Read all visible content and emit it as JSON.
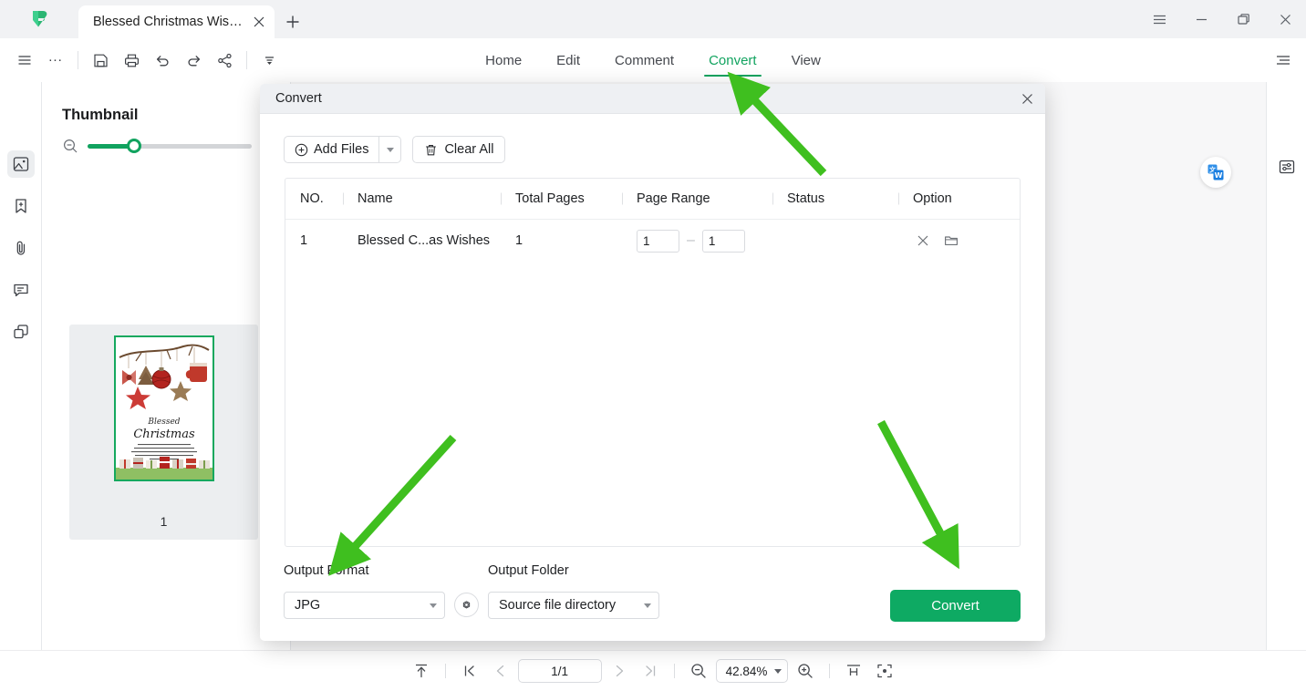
{
  "window": {
    "tab_title": "Blessed Christmas Wishe...",
    "tab_close_icon": "close-icon",
    "new_tab_icon": "plus-icon",
    "controls": [
      "hamburger-menu-icon",
      "minimize-icon",
      "restore-icon",
      "close-icon"
    ]
  },
  "toolbar": {
    "icons": [
      "hamburger-icon",
      "more-icon",
      "save-icon",
      "print-icon",
      "undo-icon",
      "redo-icon",
      "share-icon",
      "customize-icon"
    ],
    "more_label": "...",
    "collapse_ribbon_icon": "collapse-ribbon-icon"
  },
  "menu": {
    "items": [
      {
        "label": "Home",
        "active": false
      },
      {
        "label": "Edit",
        "active": false
      },
      {
        "label": "Comment",
        "active": false
      },
      {
        "label": "Convert",
        "active": true
      },
      {
        "label": "View",
        "active": false
      }
    ],
    "active_color": "#11a35f"
  },
  "rail": {
    "items": [
      {
        "name": "sidebar-item-thumbnail",
        "icon": "thumbnail-icon",
        "active": true
      },
      {
        "name": "sidebar-item-bookmark",
        "icon": "bookmark-add-icon",
        "active": false
      },
      {
        "name": "sidebar-item-attachment",
        "icon": "paperclip-icon",
        "active": false
      },
      {
        "name": "sidebar-item-comment",
        "icon": "comment-icon",
        "active": false
      },
      {
        "name": "sidebar-item-layers",
        "icon": "layers-icon",
        "active": false
      }
    ]
  },
  "thumbnail_panel": {
    "title": "Thumbnail",
    "collapse_icon": "chevron-right-icon",
    "zoom_out_icon": "zoom-out-icon",
    "zoom_in_icon": "zoom-in-icon",
    "slider_value": 26,
    "page_label": "1",
    "card": {
      "heading_script": "Blessed",
      "heading_main": "Christmas"
    }
  },
  "right_panel": {
    "translate_icon": "translate-word-icon",
    "properties_icon": "properties-panel-icon"
  },
  "dialog": {
    "title": "Convert",
    "close_icon": "close-icon",
    "add_files_label": "Add Files",
    "add_files_icon": "plus-circle-icon",
    "add_files_dropdown_icon": "chevron-down-icon",
    "clear_all_label": "Clear All",
    "clear_all_icon": "trash-icon",
    "table": {
      "columns": [
        "NO.",
        "Name",
        "Total Pages",
        "Page Range",
        "Status",
        "Option"
      ],
      "rows": [
        {
          "no": "1",
          "name": "Blessed C...as Wishes",
          "total_pages": "1",
          "page_range_from": "1",
          "page_range_to": "1",
          "range_separator": "–",
          "status": "",
          "option_icons": [
            "remove-icon",
            "folder-icon"
          ]
        }
      ]
    },
    "output_format_label": "Output Format",
    "output_format_value": "JPG",
    "output_format_settings_icon": "settings-gear-icon",
    "output_folder_label": "Output Folder",
    "output_folder_value": "Source file directory",
    "convert_button_label": "Convert",
    "convert_button_color": "#0eaa63"
  },
  "statusbar": {
    "fit_top_icon": "scroll-to-top-icon",
    "first_page_icon": "first-page-icon",
    "prev_page_icon": "previous-page-icon",
    "page_indicator": "1/1",
    "next_page_icon": "next-page-icon",
    "last_page_icon": "last-page-icon",
    "zoom_out_icon": "zoom-out-icon",
    "zoom_value": "42.84%",
    "zoom_in_icon": "zoom-in-icon",
    "fit_width_icon": "fit-width-icon",
    "fit_page_icon": "fit-page-icon"
  },
  "annotations": {
    "arrow_color": "#3fbf1f",
    "arrows": [
      {
        "name": "arrow-to-convert-tab",
        "points_to": "Convert"
      },
      {
        "name": "arrow-to-output-format",
        "points_to": "Output Format"
      },
      {
        "name": "arrow-to-convert-button",
        "points_to": "Convert button"
      }
    ]
  }
}
